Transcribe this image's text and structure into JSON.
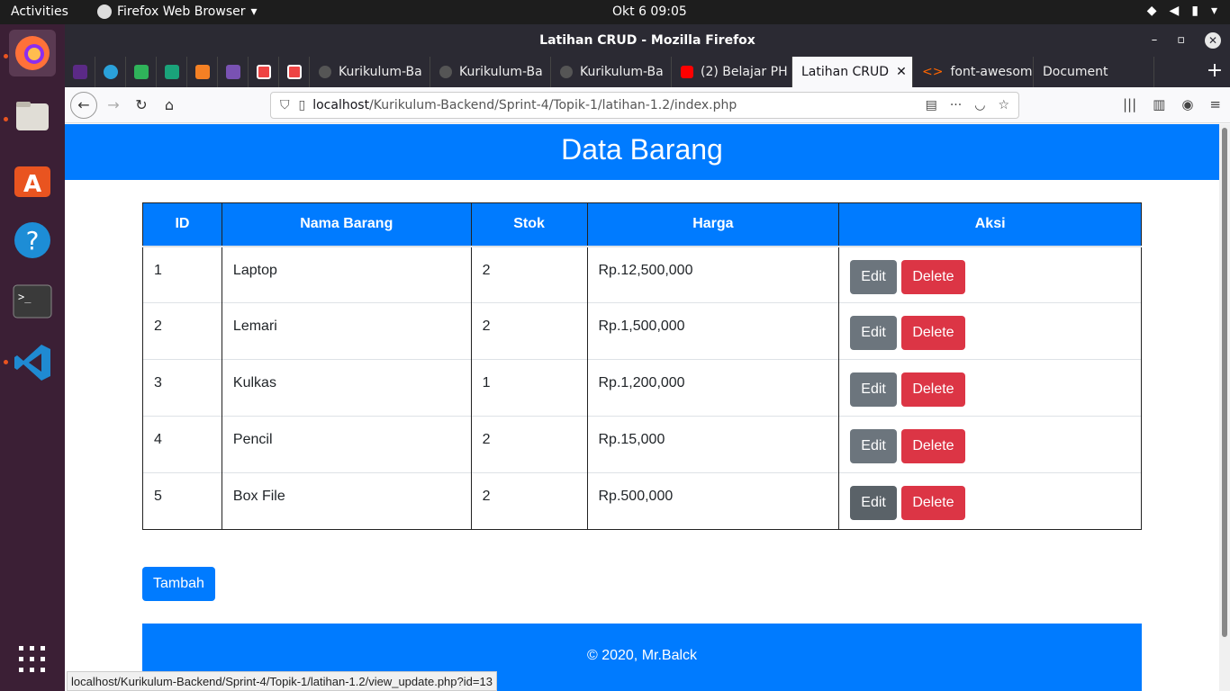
{
  "topbar": {
    "activities": "Activities",
    "app_name": "Firefox Web Browser",
    "clock": "Okt 6  09:05"
  },
  "window": {
    "title": "Latihan CRUD - Mozilla Firefox"
  },
  "tabs": [
    {
      "label": "Kurikulum-Ba"
    },
    {
      "label": "Kurikulum-Ba"
    },
    {
      "label": "Kurikulum-Ba"
    },
    {
      "label": "(2) Belajar PH"
    },
    {
      "label": "Latihan CRUD"
    },
    {
      "label": "font-awesome"
    },
    {
      "label": "Document"
    }
  ],
  "url": {
    "host": "localhost",
    "path": "/Kurikulum-Backend/Sprint-4/Topik-1/latihan-1.2/index.php"
  },
  "page": {
    "heading": "Data Barang",
    "columns": [
      "ID",
      "Nama Barang",
      "Stok",
      "Harga",
      "Aksi"
    ],
    "rows": [
      {
        "id": "1",
        "nama": "Laptop",
        "stok": "2",
        "harga": "Rp.12,500,000"
      },
      {
        "id": "2",
        "nama": "Lemari",
        "stok": "2",
        "harga": "Rp.1,500,000"
      },
      {
        "id": "3",
        "nama": "Kulkas",
        "stok": "1",
        "harga": "Rp.1,200,000"
      },
      {
        "id": "4",
        "nama": "Pencil",
        "stok": "2",
        "harga": "Rp.15,000"
      },
      {
        "id": "5",
        "nama": "Box File",
        "stok": "2",
        "harga": "Rp.500,000"
      }
    ],
    "edit_label": "Edit",
    "delete_label": "Delete",
    "add_label": "Tambah",
    "footer": "© 2020, Mr.Balck"
  },
  "status_url": "localhost/Kurikulum-Backend/Sprint-4/Topik-1/latihan-1.2/view_update.php?id=13",
  "colors": {
    "primary": "#007bff",
    "secondary": "#6c757d",
    "danger": "#dc3545"
  }
}
